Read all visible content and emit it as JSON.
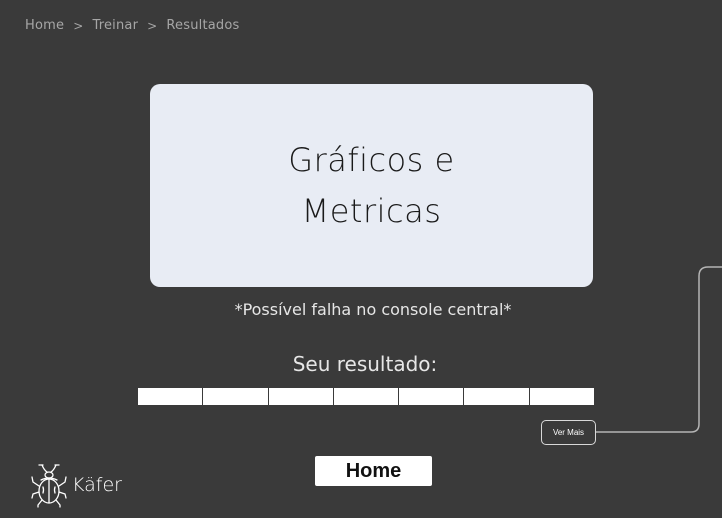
{
  "breadcrumb": {
    "items": [
      "Home",
      "Treinar",
      "Resultados"
    ],
    "separator": ">"
  },
  "card": {
    "title_line1": "Gráficos e",
    "title_line2": "Metricas"
  },
  "warning": "*Possível falha no console central*",
  "result": {
    "label": "Seu resultado:",
    "segment_count": 7
  },
  "ver_mais_label": "Ver Mais",
  "home_button_label": "Home",
  "logo": {
    "name": "Käfer",
    "icon": "beetle-icon"
  },
  "colors": {
    "background": "#3a3a3a",
    "card": "#e8ecf4",
    "segment": "#ffffff",
    "breadcrumb_text": "#a6a6a6"
  }
}
